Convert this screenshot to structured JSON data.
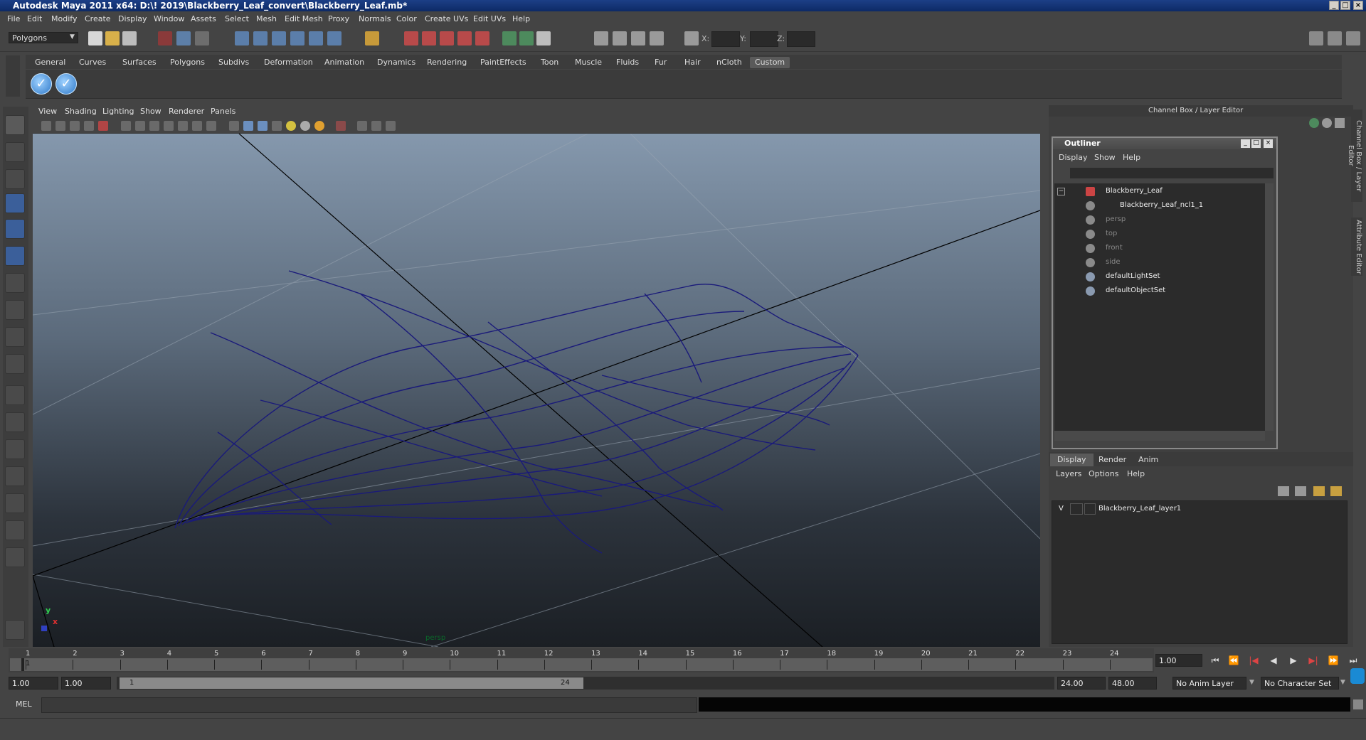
{
  "window": {
    "title": "Autodesk Maya 2011 x64: D:\\! 2019\\Blackberry_Leaf_convert\\Blackberry_Leaf.mb*"
  },
  "menubar": [
    "File",
    "Edit",
    "Modify",
    "Create",
    "Display",
    "Window",
    "Assets",
    "Select",
    "Mesh",
    "Edit Mesh",
    "Proxy",
    "Normals",
    "Color",
    "Create UVs",
    "Edit UVs",
    "Help"
  ],
  "statusline": {
    "mode": "Polygons",
    "x_label": "X:",
    "y_label": "Y:",
    "z_label": "Z:"
  },
  "shelf": {
    "tabs": [
      "General",
      "Curves",
      "Surfaces",
      "Polygons",
      "Subdivs",
      "Deformation",
      "Animation",
      "Dynamics",
      "Rendering",
      "PaintEffects",
      "Toon",
      "Muscle",
      "Fluids",
      "Fur",
      "Hair",
      "nCloth",
      "Custom"
    ],
    "active_tab": "Custom",
    "icons": [
      "checkmark-icon",
      "checkmark-icon"
    ]
  },
  "panel": {
    "menu": [
      "View",
      "Shading",
      "Lighting",
      "Show",
      "Renderer",
      "Panels"
    ],
    "camera_label": "persp",
    "axis_y": "y",
    "axis_x": "x"
  },
  "channel_box": {
    "header": "Channel Box / Layer Editor"
  },
  "outliner": {
    "title": "Outliner",
    "menu": [
      "Display",
      "Show",
      "Help"
    ],
    "items": [
      {
        "label": "Blackberry_Leaf",
        "dim": false
      },
      {
        "label": "Blackberry_Leaf_ncl1_1",
        "dim": false
      },
      {
        "label": "persp",
        "dim": true
      },
      {
        "label": "top",
        "dim": true
      },
      {
        "label": "front",
        "dim": true
      },
      {
        "label": "side",
        "dim": true
      },
      {
        "label": "defaultLightSet",
        "dim": false
      },
      {
        "label": "defaultObjectSet",
        "dim": false
      }
    ]
  },
  "layer_editor": {
    "tabs": [
      "Display",
      "Render",
      "Anim"
    ],
    "active_tab": "Display",
    "menu": [
      "Layers",
      "Options",
      "Help"
    ],
    "layers": [
      {
        "visible": "V",
        "name": "Blackberry_Leaf_layer1"
      }
    ]
  },
  "side_tabs": [
    "Channel Box / Layer Editor",
    "Attribute Editor"
  ],
  "timeline": {
    "frames": [
      "1",
      "2",
      "3",
      "4",
      "5",
      "6",
      "7",
      "8",
      "9",
      "10",
      "11",
      "12",
      "13",
      "14",
      "15",
      "16",
      "17",
      "18",
      "19",
      "20",
      "21",
      "22",
      "23",
      "24"
    ],
    "current_frame_marker": "1",
    "current_time": "1.00"
  },
  "range": {
    "start": "1.00",
    "playback_start": "1.00",
    "handle_start": "1",
    "handle_end": "24",
    "playback_end": "24.00",
    "end": "48.00",
    "anim_layer": "No Anim Layer",
    "character_set": "No Character Set"
  },
  "command_line": {
    "label": "MEL"
  },
  "colors": {
    "wireframe": "#1a1a7a",
    "title_bar": "#14357a"
  }
}
